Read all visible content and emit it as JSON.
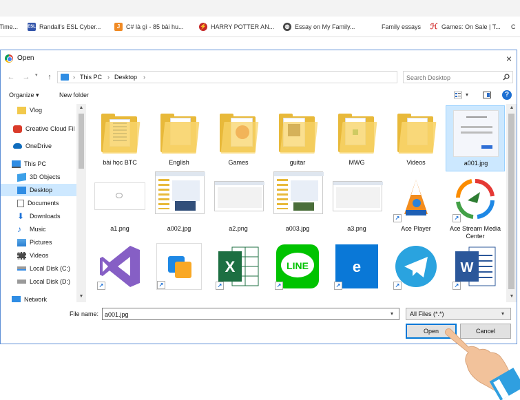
{
  "browser": {
    "bookmarks": [
      {
        "label": "Time...",
        "icon": "globe-icon"
      },
      {
        "label": "Randall's ESL Cyber...",
        "icon": "esl-icon"
      },
      {
        "label": "C# là gì - 85 bài hu...",
        "icon": "bookmark-icon"
      },
      {
        "label": "HARRY POTTER AN...",
        "icon": "harry-potter-icon"
      },
      {
        "label": "Essay on My Family...",
        "icon": "globe-icon"
      },
      {
        "label": "Family essays",
        "icon": "none"
      },
      {
        "label": "Games: On Sale | T...",
        "icon": "h-icon"
      },
      {
        "label": "C",
        "icon": "none"
      }
    ]
  },
  "dialog": {
    "title": "Open",
    "close": "×",
    "breadcrumb": [
      "This PC",
      "Desktop"
    ],
    "search_placeholder": "Search Desktop",
    "toolbar": {
      "organize": "Organize ▾",
      "new_folder": "New folder",
      "help": "?"
    },
    "sidebar": [
      {
        "label": "Vlog",
        "icon": "folder-icon",
        "selected": false
      },
      {
        "label": "Creative Cloud Fil",
        "icon": "creative-cloud-icon",
        "selected": false
      },
      {
        "label": "OneDrive",
        "icon": "onedrive-icon",
        "selected": false
      },
      {
        "label": "This PC",
        "icon": "pc-icon",
        "selected": false
      },
      {
        "label": "3D Objects",
        "icon": "3d-objects-icon",
        "selected": false
      },
      {
        "label": "Desktop",
        "icon": "desktop-icon",
        "selected": true
      },
      {
        "label": "Documents",
        "icon": "documents-icon",
        "selected": false
      },
      {
        "label": "Downloads",
        "icon": "downloads-icon",
        "selected": false
      },
      {
        "label": "Music",
        "icon": "music-icon",
        "selected": false
      },
      {
        "label": "Pictures",
        "icon": "pictures-icon",
        "selected": false
      },
      {
        "label": "Videos",
        "icon": "videos-icon",
        "selected": false
      },
      {
        "label": "Local Disk (C:)",
        "icon": "disk-icon",
        "selected": false
      },
      {
        "label": "Local Disk (D:)",
        "icon": "disk-icon",
        "selected": false
      },
      {
        "label": "Network",
        "icon": "network-icon",
        "selected": false
      }
    ],
    "files": [
      {
        "label": "bài học BTC",
        "kind": "folder"
      },
      {
        "label": "English",
        "kind": "folder"
      },
      {
        "label": "Games",
        "kind": "folder"
      },
      {
        "label": "guitar",
        "kind": "folder"
      },
      {
        "label": "MWG",
        "kind": "folder"
      },
      {
        "label": "Videos",
        "kind": "folder"
      },
      {
        "label": "a001.jpg",
        "kind": "image",
        "selected": true
      },
      {
        "label": "a1.png",
        "kind": "image"
      },
      {
        "label": "a002.jpg",
        "kind": "image"
      },
      {
        "label": "a2.png",
        "kind": "image"
      },
      {
        "label": "a003.jpg",
        "kind": "image"
      },
      {
        "label": "a3.png",
        "kind": "image"
      },
      {
        "label": "Ace Player",
        "kind": "shortcut"
      },
      {
        "label": "Ace Stream Media Center",
        "kind": "shortcut"
      },
      {
        "label": "",
        "kind": "visual-studio"
      },
      {
        "label": "",
        "kind": "app-blue"
      },
      {
        "label": "",
        "kind": "excel"
      },
      {
        "label": "",
        "kind": "line"
      },
      {
        "label": "",
        "kind": "edge"
      },
      {
        "label": "",
        "kind": "telegram"
      },
      {
        "label": "",
        "kind": "word"
      }
    ],
    "filename_label": "File name:",
    "filename_value": "a001.jpg",
    "filetype": "All Files (*.*)",
    "open_button": "Open",
    "cancel_button": "Cancel"
  },
  "colors": {
    "accent": "#0078d7",
    "selection": "#cce8ff",
    "folder": "#f8d46a"
  }
}
